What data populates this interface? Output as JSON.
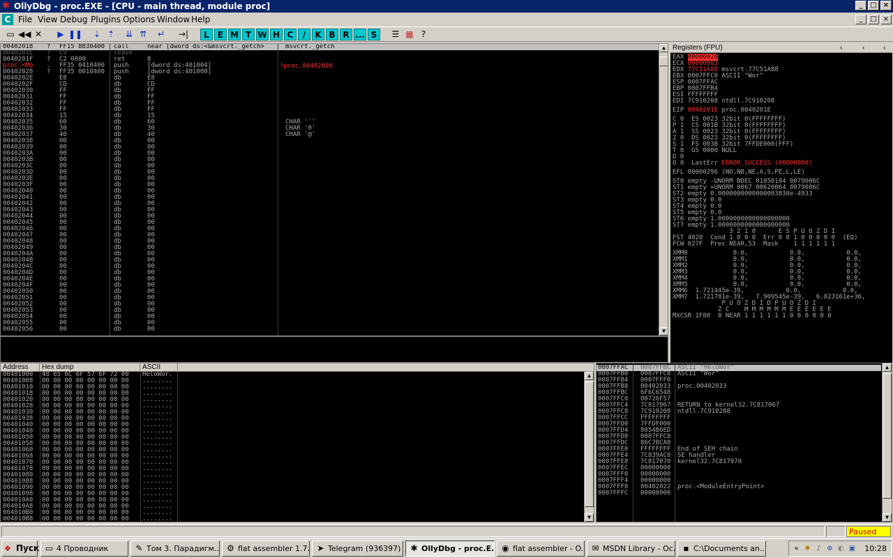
{
  "window": {
    "title": "OllyDbg - proc.EXE - [CPU - main thread, module proc]",
    "icon": "bug-icon"
  },
  "menu": {
    "mdi_icon": "C",
    "items": [
      "File",
      "View",
      "Debug",
      "Plugins",
      "Options",
      "Window",
      "Help"
    ]
  },
  "toolbar": {
    "icons": [
      "open-icon",
      "restart-icon",
      "close-icon",
      "run-icon",
      "pause-icon",
      "step-into-icon",
      "step-over-icon",
      "trace-into-icon",
      "trace-over-icon",
      "execute-till-return-icon",
      "goto-icon"
    ],
    "letters": [
      "L",
      "E",
      "M",
      "T",
      "W",
      "H",
      "C",
      "/",
      "K",
      "B",
      "R",
      "...",
      "S"
    ],
    "extra_icons": [
      "list-icon",
      "grid-icon",
      "help-icon"
    ]
  },
  "disasm": {
    "comment_jump": "└proc.00402000",
    "rows": [
      {
        "addr": "00402018",
        "mk": "?",
        "hex": "FF15 8830400",
        "cmd": "call",
        "args": "near [dword ds:<&msvcrt._getch>",
        "cmt": "msvcrt._getch",
        "style": "sel"
      },
      {
        "addr": "0040201E",
        "mk": "?",
        "hex": "C9",
        "cmd": "leave",
        "args": "",
        "cmt": "",
        "style": "sel2"
      },
      {
        "addr": "0040201F",
        "mk": "?",
        "hex": "C2 0800",
        "cmd": "ret",
        "args": "8",
        "cmt": "",
        "style": ""
      },
      {
        "addr": "proc.<Mo",
        "mk": ".",
        "hex": "FF35 0410400",
        "cmd": "push",
        "args": "[dword ds:401004]",
        "cmt": "",
        "style": "eip"
      },
      {
        "addr": "00402028",
        "mk": "?",
        "hex": "FF35 0010400",
        "cmd": "push",
        "args": "[dword ds:401000]",
        "cmt": "",
        "style": ""
      },
      {
        "addr": "0040202E",
        "mk": "",
        "hex": "E8",
        "cmd": "db",
        "args": "E8",
        "cmt": "",
        "style": ""
      },
      {
        "addr": "0040202F",
        "mk": "",
        "hex": "CD",
        "cmd": "db",
        "args": "CD",
        "cmt": "",
        "style": ""
      },
      {
        "addr": "00402030",
        "mk": "",
        "hex": "FF",
        "cmd": "db",
        "args": "FF",
        "cmt": "",
        "style": ""
      },
      {
        "addr": "00402031",
        "mk": "",
        "hex": "FF",
        "cmd": "db",
        "args": "FF",
        "cmt": "",
        "style": ""
      },
      {
        "addr": "00402032",
        "mk": "",
        "hex": "FF",
        "cmd": "db",
        "args": "FF",
        "cmt": "",
        "style": ""
      },
      {
        "addr": "00402033",
        "mk": "",
        "hex": "FF",
        "cmd": "db",
        "args": "FF",
        "cmt": "",
        "style": ""
      },
      {
        "addr": "00402034",
        "mk": "",
        "hex": "15",
        "cmd": "db",
        "args": "15",
        "cmt": "",
        "style": ""
      },
      {
        "addr": "00402035",
        "mk": "",
        "hex": "60",
        "cmd": "db",
        "args": "60",
        "cmt": "CHAR '`'",
        "style": ""
      },
      {
        "addr": "00402036",
        "mk": "",
        "hex": "30",
        "cmd": "db",
        "args": "30",
        "cmt": "CHAR '0'",
        "style": ""
      },
      {
        "addr": "00402037",
        "mk": "",
        "hex": "40",
        "cmd": "db",
        "args": "40",
        "cmt": "CHAR '@'",
        "style": ""
      },
      {
        "addr": "00402038",
        "mk": "",
        "hex": "00",
        "cmd": "db",
        "args": "00",
        "cmt": "",
        "style": ""
      },
      {
        "addr": "00402039",
        "mk": "",
        "hex": "00",
        "cmd": "db",
        "args": "00",
        "cmt": "",
        "style": ""
      },
      {
        "addr": "0040203A",
        "mk": "",
        "hex": "00",
        "cmd": "db",
        "args": "00",
        "cmt": "",
        "style": ""
      },
      {
        "addr": "0040203B",
        "mk": "",
        "hex": "00",
        "cmd": "db",
        "args": "00",
        "cmt": "",
        "style": ""
      },
      {
        "addr": "0040203C",
        "mk": "",
        "hex": "00",
        "cmd": "db",
        "args": "00",
        "cmt": "",
        "style": ""
      },
      {
        "addr": "0040203D",
        "mk": "",
        "hex": "00",
        "cmd": "db",
        "args": "00",
        "cmt": "",
        "style": ""
      },
      {
        "addr": "0040203E",
        "mk": "",
        "hex": "00",
        "cmd": "db",
        "args": "00",
        "cmt": "",
        "style": ""
      },
      {
        "addr": "0040203F",
        "mk": "",
        "hex": "00",
        "cmd": "db",
        "args": "00",
        "cmt": "",
        "style": ""
      },
      {
        "addr": "00402040",
        "mk": "",
        "hex": "00",
        "cmd": "db",
        "args": "00",
        "cmt": "",
        "style": ""
      },
      {
        "addr": "00402041",
        "mk": "",
        "hex": "00",
        "cmd": "db",
        "args": "00",
        "cmt": "",
        "style": ""
      },
      {
        "addr": "00402042",
        "mk": "",
        "hex": "00",
        "cmd": "db",
        "args": "00",
        "cmt": "",
        "style": ""
      },
      {
        "addr": "00402043",
        "mk": "",
        "hex": "00",
        "cmd": "db",
        "args": "00",
        "cmt": "",
        "style": ""
      },
      {
        "addr": "00402044",
        "mk": "",
        "hex": "00",
        "cmd": "db",
        "args": "00",
        "cmt": "",
        "style": ""
      },
      {
        "addr": "00402045",
        "mk": "",
        "hex": "00",
        "cmd": "db",
        "args": "00",
        "cmt": "",
        "style": ""
      },
      {
        "addr": "00402046",
        "mk": "",
        "hex": "00",
        "cmd": "db",
        "args": "00",
        "cmt": "",
        "style": ""
      },
      {
        "addr": "00402047",
        "mk": "",
        "hex": "00",
        "cmd": "db",
        "args": "00",
        "cmt": "",
        "style": ""
      },
      {
        "addr": "00402048",
        "mk": "",
        "hex": "00",
        "cmd": "db",
        "args": "00",
        "cmt": "",
        "style": ""
      },
      {
        "addr": "00402049",
        "mk": "",
        "hex": "00",
        "cmd": "db",
        "args": "00",
        "cmt": "",
        "style": ""
      },
      {
        "addr": "0040204A",
        "mk": "",
        "hex": "00",
        "cmd": "db",
        "args": "00",
        "cmt": "",
        "style": ""
      },
      {
        "addr": "0040204B",
        "mk": "",
        "hex": "00",
        "cmd": "db",
        "args": "00",
        "cmt": "",
        "style": ""
      },
      {
        "addr": "0040204C",
        "mk": "",
        "hex": "00",
        "cmd": "db",
        "args": "00",
        "cmt": "",
        "style": ""
      },
      {
        "addr": "0040204D",
        "mk": "",
        "hex": "00",
        "cmd": "db",
        "args": "00",
        "cmt": "",
        "style": ""
      },
      {
        "addr": "0040204E",
        "mk": "",
        "hex": "00",
        "cmd": "db",
        "args": "00",
        "cmt": "",
        "style": ""
      },
      {
        "addr": "0040204F",
        "mk": "",
        "hex": "00",
        "cmd": "db",
        "args": "00",
        "cmt": "",
        "style": ""
      },
      {
        "addr": "00402050",
        "mk": "",
        "hex": "00",
        "cmd": "db",
        "args": "00",
        "cmt": "",
        "style": ""
      },
      {
        "addr": "00402051",
        "mk": "",
        "hex": "00",
        "cmd": "db",
        "args": "00",
        "cmt": "",
        "style": ""
      },
      {
        "addr": "00402052",
        "mk": "",
        "hex": "00",
        "cmd": "db",
        "args": "00",
        "cmt": "",
        "style": ""
      },
      {
        "addr": "00402053",
        "mk": "",
        "hex": "00",
        "cmd": "db",
        "args": "00",
        "cmt": "",
        "style": ""
      },
      {
        "addr": "00402054",
        "mk": "",
        "hex": "00",
        "cmd": "db",
        "args": "00",
        "cmt": "",
        "style": ""
      },
      {
        "addr": "00402055",
        "mk": "",
        "hex": "00",
        "cmd": "db",
        "args": "00",
        "cmt": "",
        "style": ""
      },
      {
        "addr": "00402056",
        "mk": "",
        "hex": "00",
        "cmd": "db",
        "args": "00",
        "cmt": "",
        "style": ""
      }
    ]
  },
  "registers": {
    "header": "Registers (FPU)",
    "lines": [
      {
        "t": "EAX ",
        "v": "00000020",
        "r": "",
        "s": "sel"
      },
      {
        "t": "ECX ",
        "v": "00000003",
        "r": "",
        "s": "red"
      },
      {
        "t": "EDX ",
        "v": "77C51A88",
        "r": " msvcrt.77C51A88",
        "s": "red"
      },
      {
        "t": "EBX 0007FFC0 ASCII \"Wor\"",
        "v": "",
        "r": "",
        "s": ""
      },
      {
        "t": "ESP 0007FFAC",
        "v": "",
        "r": "",
        "s": ""
      },
      {
        "t": "EBP 0007FFB4",
        "v": "",
        "r": "",
        "s": ""
      },
      {
        "t": "ESI FFFFFFFF",
        "v": "",
        "r": "",
        "s": ""
      },
      {
        "t": "EDI 7C910208 ntdll.7C910208",
        "v": "",
        "r": "",
        "s": ""
      },
      {
        "t": "",
        "v": "",
        "r": "",
        "s": "gap"
      },
      {
        "t": "EIP ",
        "v": "0040201E",
        "r": " proc.0040201E",
        "s": "red"
      },
      {
        "t": "",
        "v": "",
        "r": "",
        "s": "gap"
      },
      {
        "t": "C 0  ES 0023 32bit 0(FFFFFFFF)",
        "v": "",
        "r": "",
        "s": ""
      },
      {
        "t": "P 1  CS 001B 32bit 0(FFFFFFFF)",
        "v": "",
        "r": "",
        "s": ""
      },
      {
        "t": "A 1  SS 0023 32bit 0(FFFFFFFF)",
        "v": "",
        "r": "",
        "s": ""
      },
      {
        "t": "Z 0  DS 0023 32bit 0(FFFFFFFF)",
        "v": "",
        "r": "",
        "s": ""
      },
      {
        "t": "S 1  FS 003B 32bit 7FFDE000(FFF)",
        "v": "",
        "r": "",
        "s": ""
      },
      {
        "t": "T 0  GS 0000 NULL",
        "v": "",
        "r": "",
        "s": ""
      },
      {
        "t": "D 0",
        "v": "",
        "r": "",
        "s": ""
      },
      {
        "t": "O 0  LastErr ",
        "v": "ERROR_SUCCESS (00000000)",
        "r": "",
        "s": "red"
      },
      {
        "t": "",
        "v": "",
        "r": "",
        "s": "gap"
      },
      {
        "t": "EFL 00000296 (NO,NB,NE,A,S,PE,L,LE)",
        "v": "",
        "r": "",
        "s": ""
      },
      {
        "t": "",
        "v": "",
        "r": "",
        "s": "gap"
      },
      {
        "t": "ST0 empty -UNORM BDEC 01050104 0079006C",
        "v": "",
        "r": "",
        "s": ""
      },
      {
        "t": "ST1 empty +UNORM 0067 00620064 0079006C",
        "v": "",
        "r": "",
        "s": ""
      },
      {
        "t": "ST2 empty 0.0000000000000003830e-4933",
        "v": "",
        "r": "",
        "s": ""
      },
      {
        "t": "ST3 empty 0.0",
        "v": "",
        "r": "",
        "s": ""
      },
      {
        "t": "ST4 empty 0.0",
        "v": "",
        "r": "",
        "s": ""
      },
      {
        "t": "ST5 empty 0.0",
        "v": "",
        "r": "",
        "s": ""
      },
      {
        "t": "ST6 empty 1.0000000000000000000",
        "v": "",
        "r": "",
        "s": ""
      },
      {
        "t": "ST7 empty 1.0000000000000000000",
        "v": "",
        "r": "",
        "s": ""
      },
      {
        "t": "               3 2 1 0      E S P U O Z D I",
        "v": "",
        "r": "",
        "s": ""
      },
      {
        "t": "FST 4020  Cond 1 0 0 0  Err 0 0 1 0 0 0 0 0  (EQ)",
        "v": "",
        "r": "",
        "s": ""
      },
      {
        "t": "FCW 027F  Prec NEAR,53  Mask    1 1 1 1 1 1",
        "v": "",
        "r": "",
        "s": ""
      },
      {
        "t": "",
        "v": "",
        "r": "",
        "s": "gap"
      },
      {
        "t": "XMM0            0.0,           0.0,           0.0,",
        "v": "",
        "r": "",
        "s": ""
      },
      {
        "t": "XMM1            0.0,           0.0,           0.0,",
        "v": "",
        "r": "",
        "s": ""
      },
      {
        "t": "XMM2            0.0,           0.0,           0.0,",
        "v": "",
        "r": "",
        "s": ""
      },
      {
        "t": "XMM3            0.0,           0.0,           0.0,",
        "v": "",
        "r": "",
        "s": ""
      },
      {
        "t": "XMM4            0.0,           0.0,           0.0,",
        "v": "",
        "r": "",
        "s": ""
      },
      {
        "t": "XMM5            0.0,           0.0,           0.0,",
        "v": "",
        "r": "",
        "s": ""
      },
      {
        "t": "XMM6  1.721445e-39,           0.0,           0.0,",
        "v": "",
        "r": "",
        "s": ""
      },
      {
        "t": "XMM7  1.721781e-39,   7.909545e-39,   6.023161e+36,",
        "v": "",
        "r": "",
        "s": ""
      },
      {
        "t": "             P U O Z D I D P U O Z D I",
        "v": "",
        "r": "",
        "s": ""
      },
      {
        "t": "            Z C    M M M M M M E E E E E E",
        "v": "",
        "r": "",
        "s": ""
      },
      {
        "t": "MXCSR 1F80  0 NEAR 1 1 1 1 1 1 0 0 0 0 0 0",
        "v": "",
        "r": "",
        "s": ""
      }
    ]
  },
  "dump": {
    "headers": [
      "Address",
      "Hex dump",
      "ASCII"
    ],
    "rows": [
      [
        "00401000",
        "48 65 6C 6F 57 6F 72 00",
        "HeloWor."
      ],
      [
        "00401008",
        "00 00 00 00 00 00 00 00",
        "........"
      ],
      [
        "00401010",
        "00 00 00 00 00 00 00 00",
        "........"
      ],
      [
        "00401018",
        "00 00 00 00 00 00 00 00",
        "........"
      ],
      [
        "00401020",
        "00 00 00 00 00 00 00 00",
        "........"
      ],
      [
        "00401028",
        "00 00 00 00 00 00 00 00",
        "........"
      ],
      [
        "00401030",
        "00 00 00 00 00 00 00 00",
        "........"
      ],
      [
        "00401038",
        "00 00 00 00 00 00 00 00",
        "........"
      ],
      [
        "00401040",
        "00 00 00 00 00 00 00 00",
        "........"
      ],
      [
        "00401048",
        "00 00 00 00 00 00 00 00",
        "........"
      ],
      [
        "00401050",
        "00 00 00 00 00 00 00 00",
        "........"
      ],
      [
        "00401058",
        "00 00 00 00 00 00 00 00",
        "........"
      ],
      [
        "00401060",
        "00 00 00 00 00 00 00 00",
        "........"
      ],
      [
        "00401068",
        "00 00 00 00 00 00 00 00",
        "........"
      ],
      [
        "00401070",
        "00 00 00 00 00 00 00 00",
        "........"
      ],
      [
        "00401078",
        "00 00 00 00 00 00 00 00",
        "........"
      ],
      [
        "00401080",
        "00 00 00 00 00 00 00 00",
        "........"
      ],
      [
        "00401088",
        "00 00 00 00 00 00 00 00",
        "........"
      ],
      [
        "00401090",
        "00 00 00 00 00 00 00 00",
        "........"
      ],
      [
        "00401098",
        "00 00 00 00 00 00 00 00",
        "........"
      ],
      [
        "004010A0",
        "00 00 00 00 00 00 00 00",
        "........"
      ],
      [
        "004010A8",
        "00 00 00 00 00 00 00 00",
        "........"
      ],
      [
        "004010B0",
        "00 00 00 00 00 00 00 00",
        "........"
      ],
      [
        "004010B8",
        "00 00 00 00 00 00 00 00",
        "........"
      ]
    ]
  },
  "stack": {
    "rows": [
      [
        "0007FFAC",
        "0007FFBC",
        "ASCII \"HeloWor\""
      ],
      [
        "0007FFB0",
        "0007FFC0",
        "ASCII \"Wor\""
      ],
      [
        "0007FFB4",
        "0007FFF0",
        ""
      ],
      [
        "0007FFB8",
        "00402033",
        "proc.00402033"
      ],
      [
        "0007FFBC",
        "6F6C6548",
        ""
      ],
      [
        "0007FFC0",
        "00726F57",
        ""
      ],
      [
        "0007FFC4",
        "7C817067",
        "RETURN to kernel32.7C817067"
      ],
      [
        "0007FFC8",
        "7C910208",
        "ntdll.7C910208"
      ],
      [
        "0007FFCC",
        "FFFFFFFF",
        ""
      ],
      [
        "0007FFD0",
        "7FFDF000",
        ""
      ],
      [
        "0007FFD4",
        "8054B6ED",
        ""
      ],
      [
        "0007FFD8",
        "0007FFC8",
        ""
      ],
      [
        "0007FFDC",
        "86C7BCA0",
        ""
      ],
      [
        "0007FFE0",
        "FFFFFFFF",
        "End of SEH chain"
      ],
      [
        "0007FFE4",
        "7C839AC0",
        "SE handler"
      ],
      [
        "0007FFE8",
        "7C817070",
        "kernel32.7C817070"
      ],
      [
        "0007FFEC",
        "00000000",
        ""
      ],
      [
        "0007FFF0",
        "00000000",
        ""
      ],
      [
        "0007FFF4",
        "00000000",
        ""
      ],
      [
        "0007FFF8",
        "00402022",
        "proc.<ModuleEntryPoint>"
      ],
      [
        "0007FFFC",
        "00000000",
        ""
      ]
    ]
  },
  "status": {
    "state": "Paused"
  },
  "taskbar": {
    "start": "Пуск",
    "buttons": [
      {
        "label": "4 Проводник",
        "icon": "folder-icon",
        "active": false
      },
      {
        "label": "Том 3. Парадигм...",
        "icon": "notepad-icon",
        "active": false
      },
      {
        "label": "flat assembler 1.7...",
        "icon": "tools-icon",
        "active": false
      },
      {
        "label": "Telegram (936397)",
        "icon": "telegram-icon",
        "active": false
      },
      {
        "label": "OllyDbg - proc.E...",
        "icon": "bug-icon",
        "active": true
      },
      {
        "label": "flat assembler - O...",
        "icon": "firefox-icon",
        "active": false
      },
      {
        "label": "MSDN Library - Oc...",
        "icon": "msdn-icon",
        "active": false
      },
      {
        "label": "C:\\Documents an...",
        "icon": "console-icon",
        "active": false
      }
    ],
    "clock": "10:28"
  },
  "colors": {
    "accent_red": "#ff3030",
    "paused_bg": "#ffff00",
    "selection": "#c0c0c0",
    "titlebar": "#0a246a"
  }
}
